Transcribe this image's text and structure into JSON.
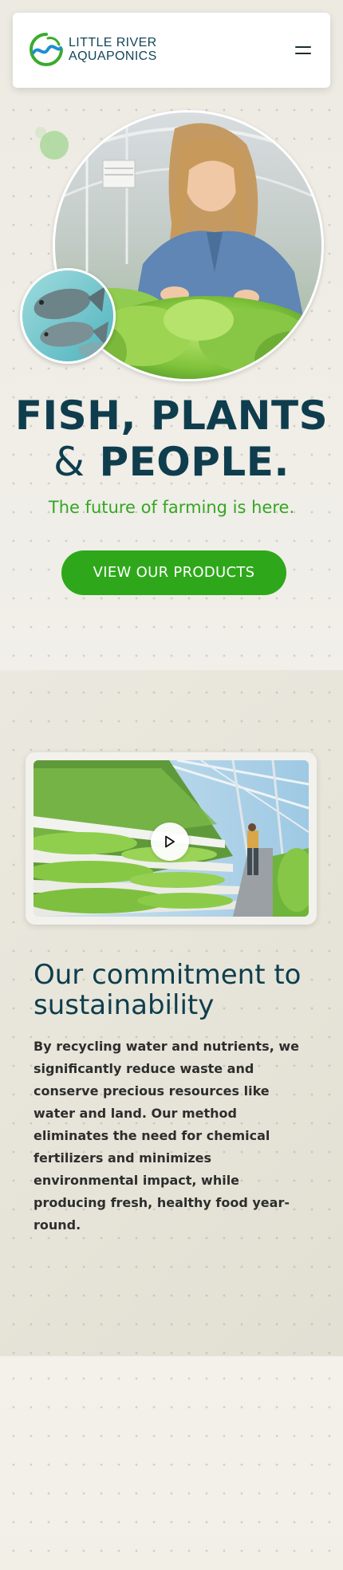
{
  "header": {
    "logo_line1": "LITTLE RIVER",
    "logo_line2": "AQUAPONICS",
    "menu_icon": "hamburger-menu-icon"
  },
  "hero": {
    "title_line1": "FISH, PLANTS",
    "title_amp": "&",
    "title_line2": "PEOPLE.",
    "tagline": "The future of farming is here.",
    "cta_label": "VIEW OUR PRODUCTS"
  },
  "commitment": {
    "video_play_icon": "play-icon",
    "title": "Our commitment to sustainability",
    "body": "By recycling water and nutrients, we significantly reduce waste and conserve precious resources like water and land. Our method eliminates the need for chemical fertilizers and minimizes environmental impact, while producing fresh, healthy food year-round."
  },
  "colors": {
    "brand_navy": "#0f3d4d",
    "brand_green": "#2ea81a",
    "tagline_green": "#35a623",
    "logo_blue": "#1e8fcf"
  }
}
